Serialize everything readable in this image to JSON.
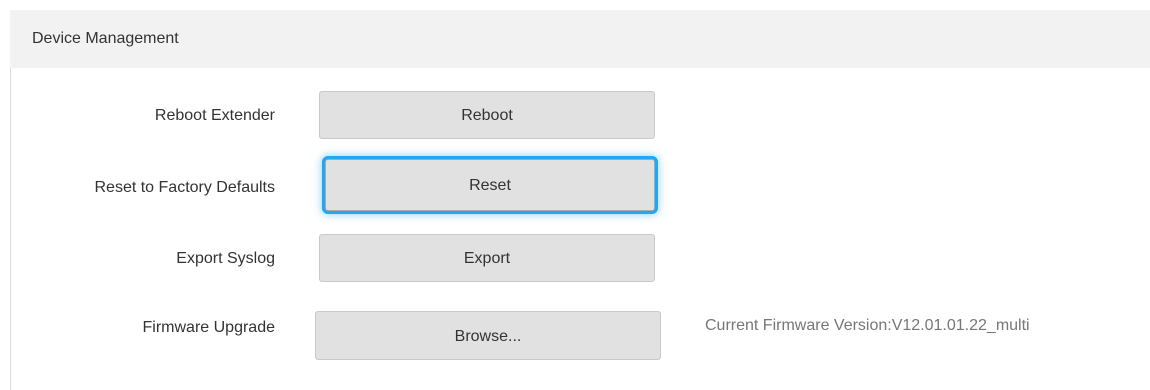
{
  "section": {
    "title": "Device Management"
  },
  "rows": [
    {
      "label": "Reboot Extender",
      "button": "Reboot"
    },
    {
      "label": "Reset to Factory Defaults",
      "button": "Reset"
    },
    {
      "label": "Export Syslog",
      "button": "Export"
    },
    {
      "label": "Firmware Upgrade",
      "button": "Browse..."
    }
  ],
  "firmware": {
    "current": "Current Firmware Version:V12.01.01.22_multi"
  },
  "colors": {
    "focus_ring": "#22a7f0",
    "button_bg": "#e1e1e1",
    "header_bg": "#f2f2f2"
  }
}
